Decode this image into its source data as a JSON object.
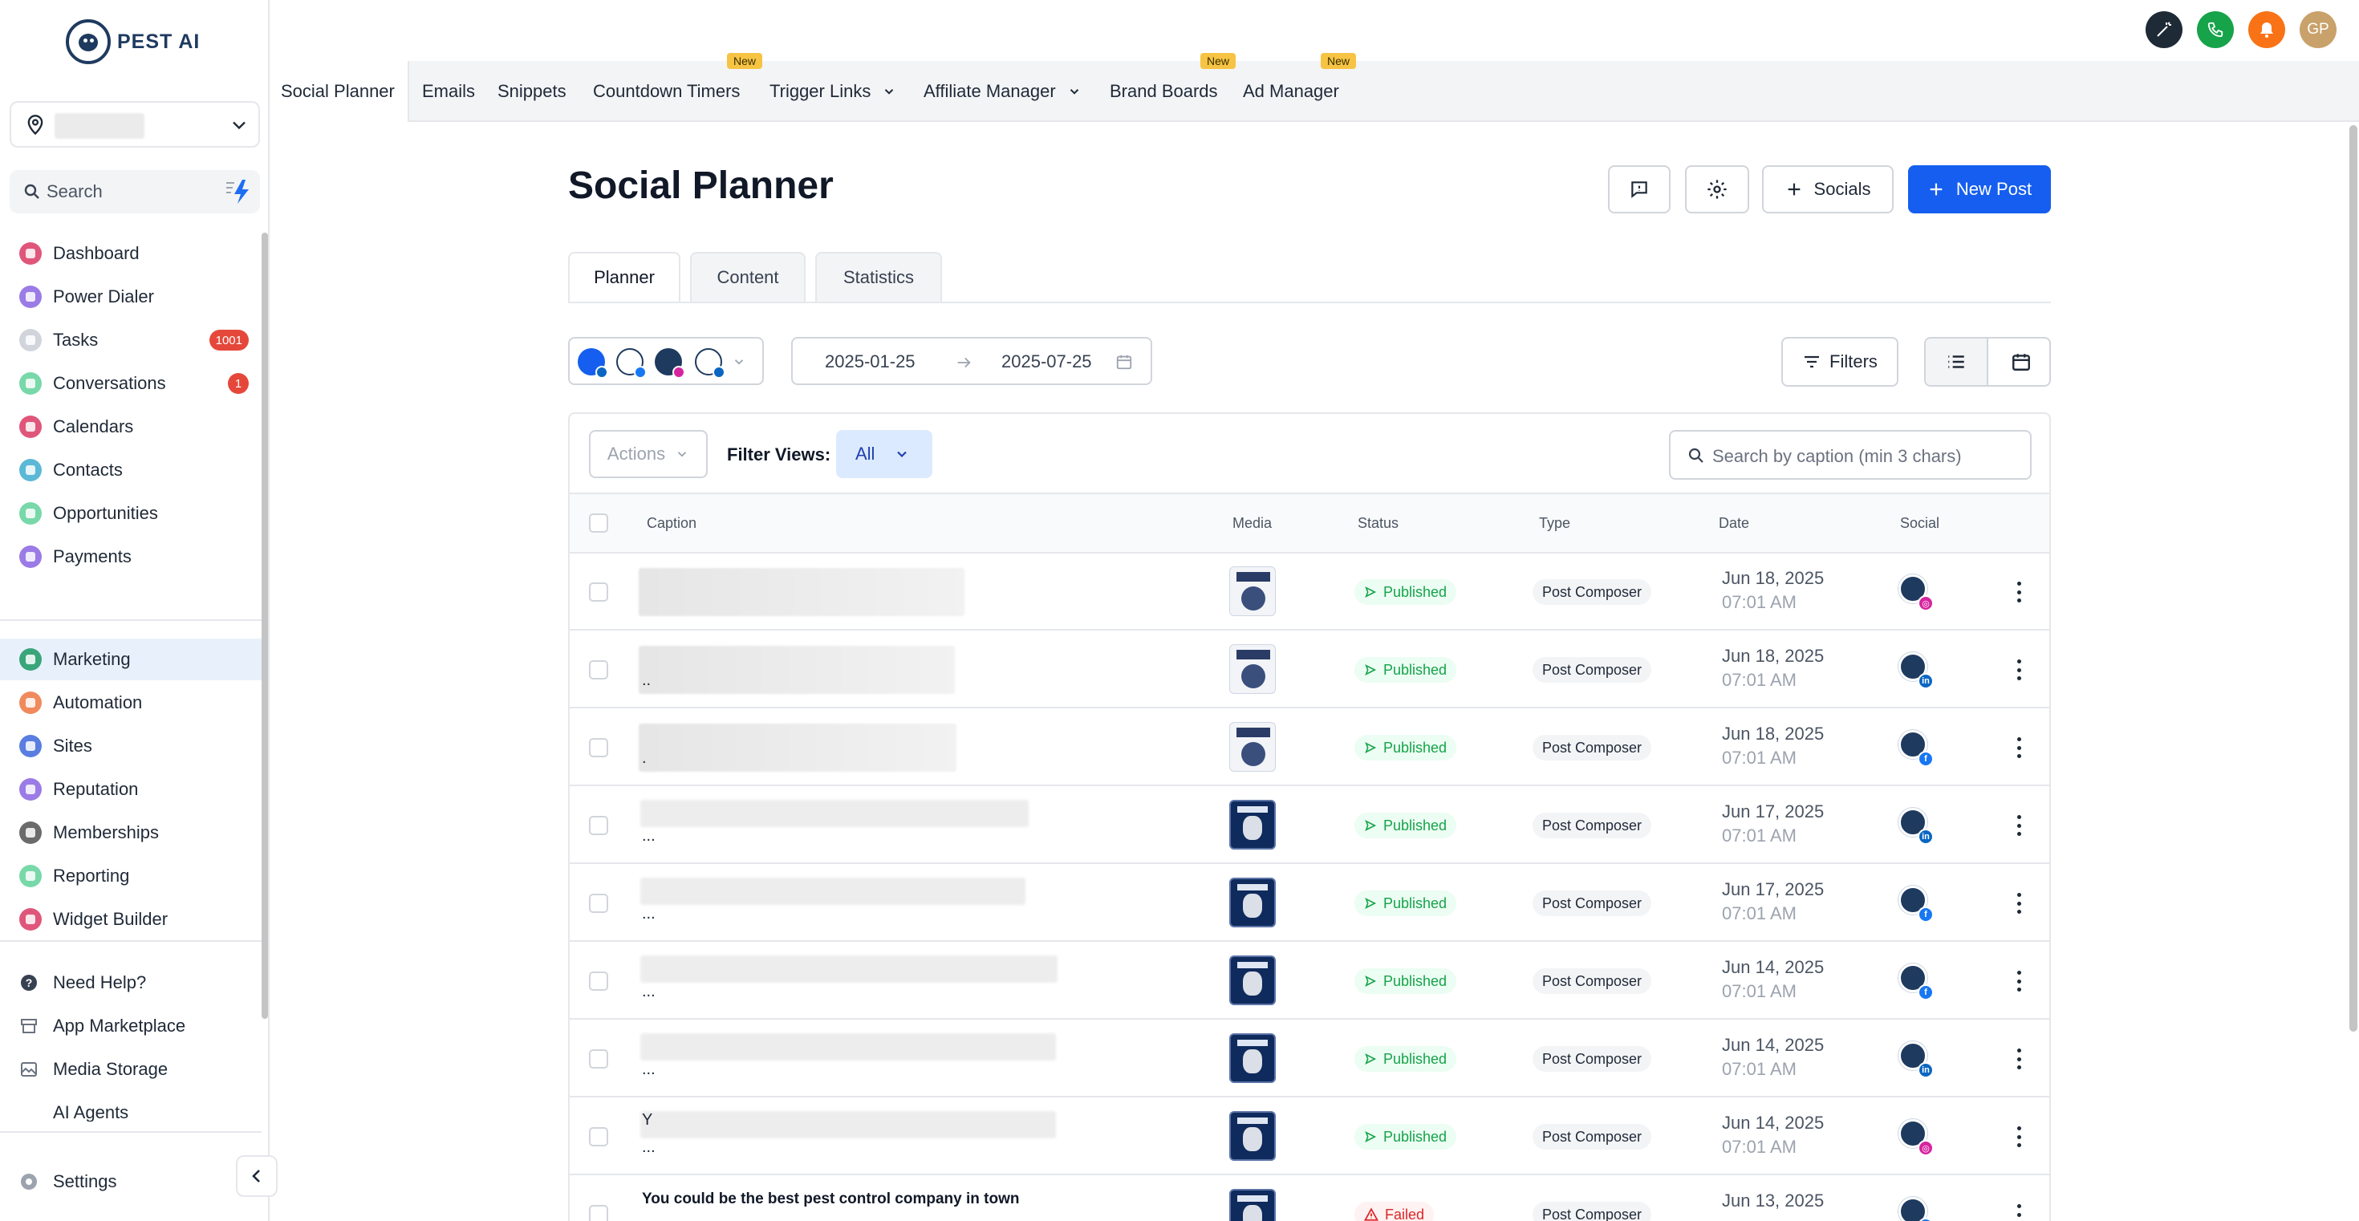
{
  "brand": {
    "name": "PEST AI"
  },
  "sidebar": {
    "search_label": "Search",
    "nav": [
      {
        "label": "Dashboard",
        "icon": "dashboard-icon",
        "color": "#e0567a"
      },
      {
        "label": "Power Dialer",
        "icon": "phone-icon",
        "color": "#9b7be6"
      },
      {
        "label": "Tasks",
        "icon": "check-icon",
        "color": "#d1d5db",
        "badge": "1001"
      },
      {
        "label": "Conversations",
        "icon": "chat-icon",
        "color": "#78d8a9",
        "badge": "1"
      },
      {
        "label": "Calendars",
        "icon": "calendar-icon",
        "color": "#e0567a"
      },
      {
        "label": "Contacts",
        "icon": "contacts-icon",
        "color": "#5bb8d6"
      },
      {
        "label": "Opportunities",
        "icon": "filter-icon",
        "color": "#78d8a9"
      },
      {
        "label": "Payments",
        "icon": "payments-icon",
        "color": "#9b7be6"
      }
    ],
    "nav2": [
      {
        "label": "Marketing",
        "icon": "marketing-icon",
        "color": "#3aa57a",
        "active": true
      },
      {
        "label": "Automation",
        "icon": "automation-icon",
        "color": "#f08a5d"
      },
      {
        "label": "Sites",
        "icon": "sites-icon",
        "color": "#5a7de0"
      },
      {
        "label": "Reputation",
        "icon": "star-icon",
        "color": "#9b7be6"
      },
      {
        "label": "Memberships",
        "icon": "memberships-icon",
        "color": "#6b6b6b"
      },
      {
        "label": "Reporting",
        "icon": "reporting-icon",
        "color": "#78d8a9"
      },
      {
        "label": "Widget Builder",
        "icon": "widget-icon",
        "color": "#e0567a"
      }
    ],
    "help": [
      {
        "label": "Need Help?",
        "icon": "help-icon"
      },
      {
        "label": "App Marketplace",
        "icon": "marketplace-icon"
      },
      {
        "label": "Media Storage",
        "icon": "media-icon"
      },
      {
        "label": "AI Agents",
        "icon": "ai-agents-icon"
      }
    ],
    "settings_label": "Settings"
  },
  "topbar": {
    "avatar_initials": "GP"
  },
  "app_tabs": [
    {
      "label": "Social Planner",
      "active": true
    },
    {
      "label": "Emails"
    },
    {
      "label": "Snippets"
    },
    {
      "label": "Countdown Timers",
      "new": "New"
    },
    {
      "label": "Trigger Links",
      "dropdown": true
    },
    {
      "label": "Affiliate Manager",
      "dropdown": true
    },
    {
      "label": "Brand Boards",
      "new": "New"
    },
    {
      "label": "Ad Manager",
      "new": "New"
    }
  ],
  "page": {
    "title": "Social Planner",
    "socials_label": "Socials",
    "new_post_label": "New Post",
    "sub_tabs": [
      "Planner",
      "Content",
      "Statistics"
    ]
  },
  "toolbar": {
    "date_from": "2025-01-25",
    "date_to": "2025-07-25",
    "filters_label": "Filters"
  },
  "table": {
    "actions_label": "Actions",
    "filter_views_label": "Filter Views:",
    "filter_view_value": "All",
    "search_placeholder": "Search by caption (min 3 chars)",
    "columns": [
      "Caption",
      "Media",
      "Status",
      "Type",
      "Date",
      "Social"
    ],
    "rows": [
      {
        "caption": "",
        "suffix": "",
        "media": "light",
        "status": "Published",
        "type": "Post Composer",
        "date": "Jun 18, 2025",
        "time": "07:01 AM",
        "network": "instagram"
      },
      {
        "caption": "",
        "suffix": "..",
        "media": "light",
        "status": "Published",
        "type": "Post Composer",
        "date": "Jun 18, 2025",
        "time": "07:01 AM",
        "network": "linkedin"
      },
      {
        "caption": "",
        "suffix": ".",
        "media": "light",
        "status": "Published",
        "type": "Post Composer",
        "date": "Jun 18, 2025",
        "time": "07:01 AM",
        "network": "facebook"
      },
      {
        "caption": "",
        "suffix": "...",
        "media": "dark",
        "status": "Published",
        "type": "Post Composer",
        "date": "Jun 17, 2025",
        "time": "07:01 AM",
        "network": "linkedin"
      },
      {
        "caption": "",
        "suffix": "...",
        "media": "dark",
        "status": "Published",
        "type": "Post Composer",
        "date": "Jun 17, 2025",
        "time": "07:01 AM",
        "network": "facebook"
      },
      {
        "caption": "",
        "suffix": "...",
        "media": "dark",
        "status": "Published",
        "type": "Post Composer",
        "date": "Jun 14, 2025",
        "time": "07:01 AM",
        "network": "facebook"
      },
      {
        "caption": "",
        "suffix": "...",
        "media": "dark",
        "status": "Published",
        "type": "Post Composer",
        "date": "Jun 14, 2025",
        "time": "07:01 AM",
        "network": "linkedin"
      },
      {
        "caption": "Y",
        "suffix": "...",
        "media": "dark",
        "status": "Published",
        "type": "Post Composer",
        "date": "Jun 14, 2025",
        "time": "07:01 AM",
        "network": "instagram"
      },
      {
        "caption": "You could be the best pest control company in town",
        "suffix": "",
        "media": "dark",
        "status": "Failed",
        "type": "Post Composer",
        "date": "Jun 13, 2025",
        "time": "",
        "network": "facebook"
      }
    ]
  },
  "colors": {
    "primary": "#155eef",
    "published": "#16a34a",
    "failed": "#dc2626",
    "facebook": "#1877f2",
    "linkedin": "#0a66c2",
    "instagram": "#d6249f"
  }
}
